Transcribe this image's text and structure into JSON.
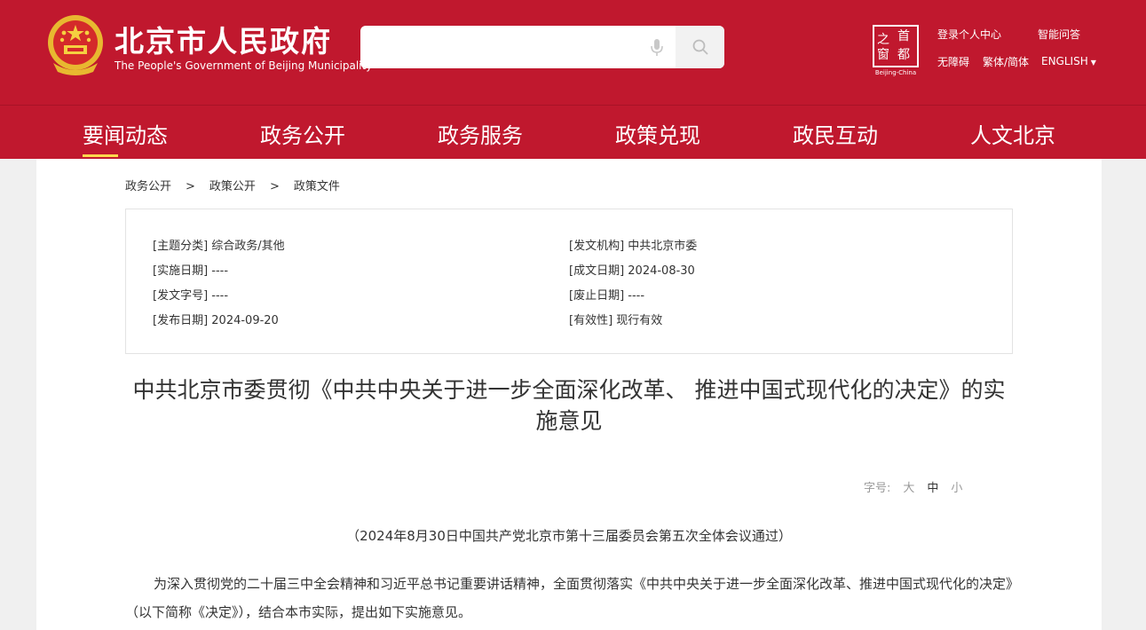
{
  "header": {
    "logo_cn": "北京市人民政府",
    "logo_en": "The People's Government of Beijing Municipality",
    "search": {
      "placeholder": ""
    },
    "capital": {
      "c1": "之",
      "c2": "首",
      "c3": "窗",
      "c4": "都",
      "tag": "Beijing-China"
    },
    "links": {
      "login": "登录个人中心",
      "qa": "智能问答",
      "accessible": "无障碍",
      "tradsimp": "繁体/简体",
      "english": "ENGLISH"
    }
  },
  "nav": {
    "items": [
      "要闻动态",
      "政务公开",
      "政务服务",
      "政策兑现",
      "政民互动",
      "人文北京"
    ]
  },
  "breadcrumb": [
    "政务公开",
    "政策公开",
    "政策文件"
  ],
  "breadcrumb_sep": ">",
  "meta": {
    "topic": "[主题分类] 综合政务/其他",
    "issuer": "[发文机构] 中共北京市委",
    "effective_date": "[实施日期] ----",
    "written_date": "[成文日期] 2024-08-30",
    "doc_number": "[发文字号] ----",
    "expiry_date": "[废止日期] ----",
    "publish_date": "[发布日期] 2024-09-20",
    "validity": "[有效性] 现行有效"
  },
  "article": {
    "title": "中共北京市委贯彻《中共中央关于进一步全面深化改革、 推进中国式现代化的决定》的实施意见",
    "font_size_label": "字号:",
    "font_sizes": [
      "大",
      "中",
      "小"
    ],
    "subtitle": "（2024年8月30日中国共产党北京市第十三届委员会第五次全体会议通过）",
    "paragraph": "为深入贯彻党的二十届三中全会精神和习近平总书记重要讲话精神，全面贯彻落实《中共中央关于进一步全面深化改革、推进中国式现代化的决定》（以下简称《决定》），结合本市实际，提出如下实施意见。"
  },
  "colors": {
    "brand_red": "#c0182e",
    "gold": "#ffd84d"
  },
  "icons": {
    "emblem": "national-emblem-icon",
    "mic": "microphone-icon",
    "search": "search-icon",
    "english_caret": "caret-down-icon"
  }
}
